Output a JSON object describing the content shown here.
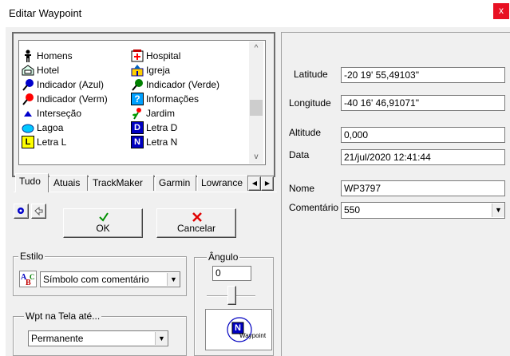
{
  "window": {
    "title": "Editar Waypoint",
    "close_glyph": "x"
  },
  "symbols": [
    {
      "label": "Homens",
      "icon": "men-icon"
    },
    {
      "label": "Hospital",
      "icon": "hospital-icon"
    },
    {
      "label": "Hotel",
      "icon": "hotel-icon"
    },
    {
      "label": "Igreja",
      "icon": "church-icon"
    },
    {
      "label": "Indicador (Azul)",
      "icon": "blue-pin-icon"
    },
    {
      "label": "Indicador (Verde)",
      "icon": "green-pin-icon"
    },
    {
      "label": "Indicador (Verm)",
      "icon": "red-pin-icon"
    },
    {
      "label": "Informações",
      "icon": "info-icon"
    },
    {
      "label": "Interseção",
      "icon": "triangle-icon"
    },
    {
      "label": "Jardim",
      "icon": "garden-icon"
    },
    {
      "label": "Lagoa",
      "icon": "lagoon-icon"
    },
    {
      "label": "Letra D",
      "icon": "letter-d-icon"
    },
    {
      "label": "Letra L",
      "icon": "letter-l-icon"
    },
    {
      "label": "Letra N",
      "icon": "letter-n-icon"
    }
  ],
  "letters": {
    "d": "D",
    "l": "L",
    "n": "N",
    "info": "?"
  },
  "tabs": [
    "Tudo",
    "Atuais",
    "TrackMaker",
    "Garmin",
    "Lowrance"
  ],
  "tab_active": "Tudo",
  "buttons": {
    "ok": "OK",
    "cancel": "Cancelar"
  },
  "estilo": {
    "title": "Estilo",
    "value": "Símbolo com comentário"
  },
  "angulo": {
    "title": "Ângulo",
    "value": "0",
    "preview_label": "Waypoint",
    "preview_letter": "N"
  },
  "wpt": {
    "title": "Wpt na Tela até...",
    "value": "Permanente"
  },
  "fields": {
    "latitude_label": "Latitude",
    "latitude": "-20 19' 55,49103\"",
    "longitude_label": "Longitude",
    "longitude": "-40 16' 46,91071\"",
    "altitude_label": "Altitude",
    "altitude": "0,000",
    "data_label": "Data",
    "data": "21/jul/2020 12:41:44",
    "nome_label": "Nome",
    "nome": "WP3797",
    "comentario_label": "Comentário",
    "comentario": "550"
  },
  "colors": {
    "close_red": "#e81123",
    "pin_blue": "#0000cc",
    "pin_green": "#008000",
    "pin_red": "#ff0000",
    "face": "#f0f0f0"
  }
}
